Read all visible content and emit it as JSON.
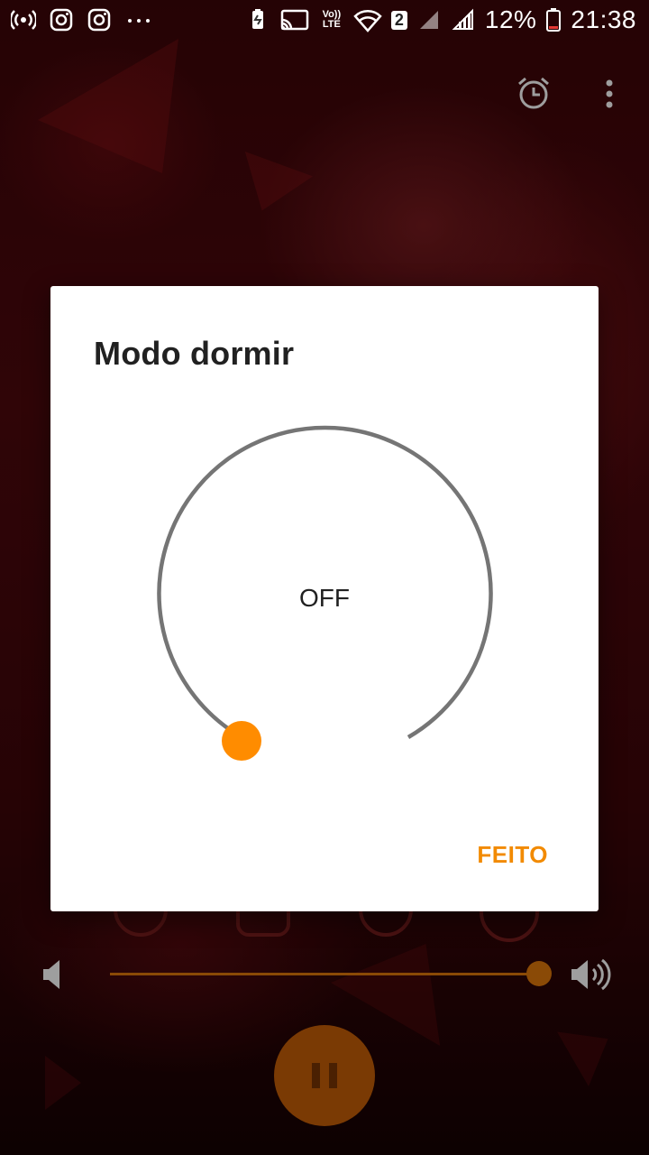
{
  "status_bar": {
    "icons_left": [
      "hotspot-icon",
      "instagram-icon",
      "instagram-icon",
      "more-notifications-icon"
    ],
    "icons_right": [
      "battery-saver-icon",
      "cast-icon",
      "volte-icon",
      "wifi-icon",
      "sim2-signal-icon",
      "sim1-signal-icon",
      "battery-icon"
    ],
    "volte_text": "Vo)) LTE",
    "sim_badge": "2",
    "battery_percent": "12%",
    "time": "21:38"
  },
  "toolbar": {
    "alarm_icon": "alarm-clock-icon",
    "menu_icon": "more-vert-icon"
  },
  "dialog": {
    "title": "Modo dormir",
    "timer_value": "OFF",
    "timer_level": 0,
    "done_label": "FEITO"
  },
  "player": {
    "volume_level": 1.0,
    "share_icons": [
      "facebook-icon",
      "instagram-icon",
      "messenger-icon",
      "whatsapp-icon"
    ],
    "pause_icon": "pause-icon"
  },
  "colors": {
    "accent": "#f28a00",
    "dial_track": "#757575",
    "player_accent": "#8a4a06"
  }
}
